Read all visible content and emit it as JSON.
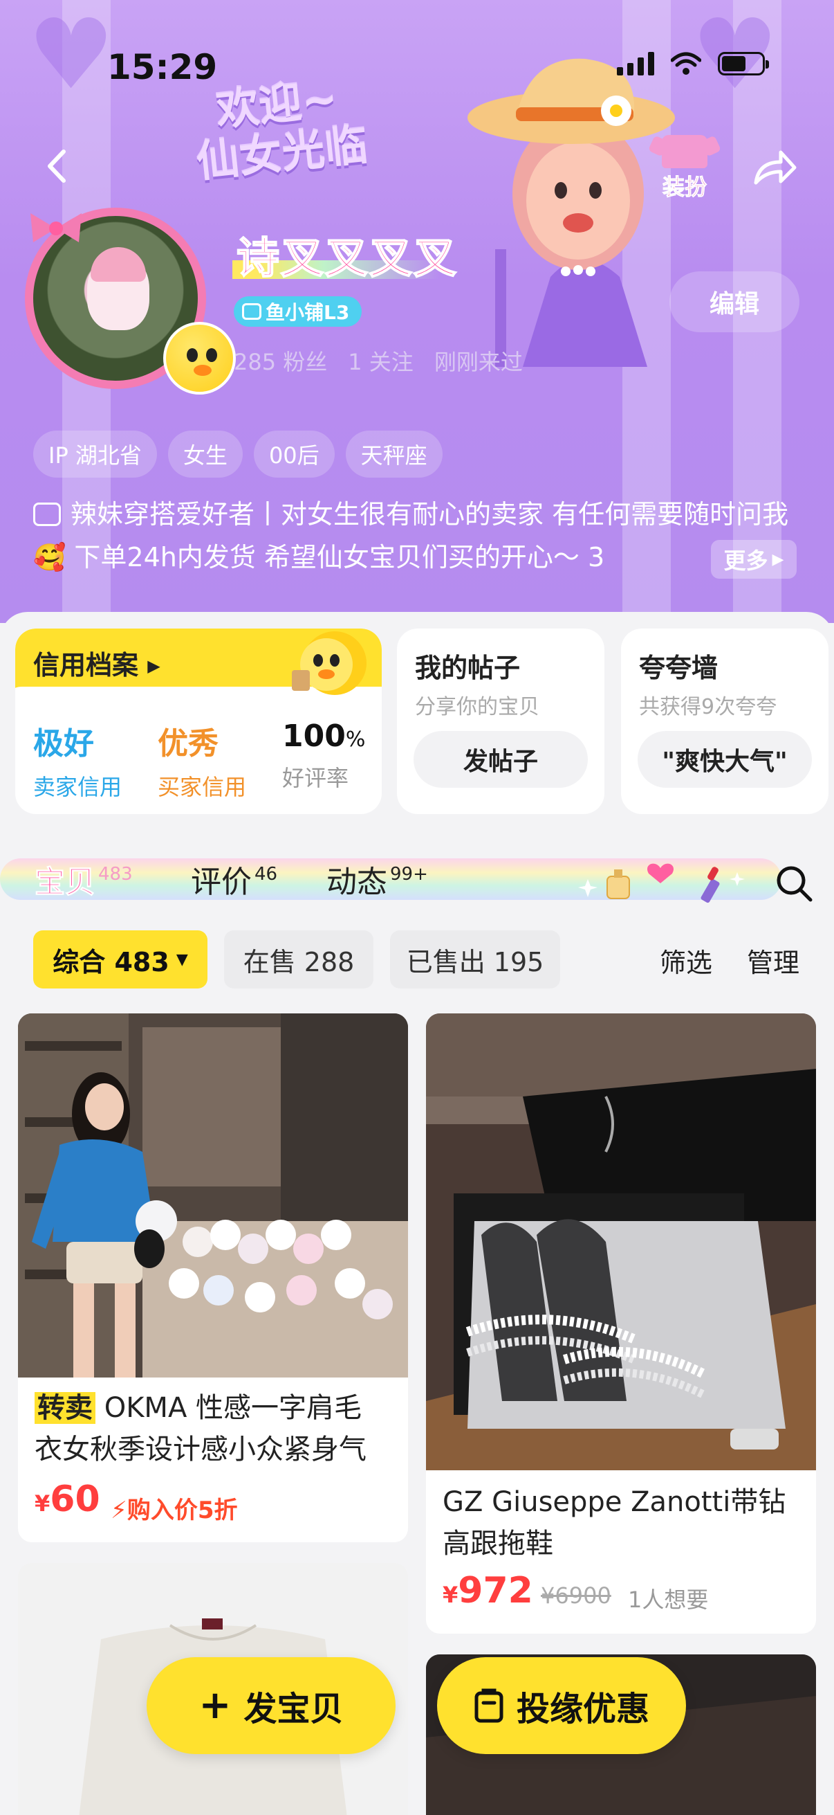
{
  "status_bar": {
    "time": "15:29"
  },
  "header": {
    "banner_line1": "欢迎~",
    "banner_line2": "仙女光临",
    "dressup_label": "装扮",
    "nickname": "诗叉叉叉叉",
    "shop_level": "鱼小铺L3",
    "stats": {
      "fans": "285 粉丝",
      "following": "1 关注",
      "last_seen": "刚刚来过"
    },
    "edit_label": "编辑",
    "tags": [
      "IP 湖北省",
      "女生",
      "00后",
      "天秤座"
    ],
    "bio": "辣妹穿搭爱好者丨对女生很有耐心的卖家 有任何需要随时问我🥰 下单24h内发货 希望仙女宝贝们买的开心～ 3",
    "more_label": "更多"
  },
  "credit_card": {
    "title": "信用档案",
    "seller": {
      "value": "极好",
      "label": "卖家信用",
      "color": "#2aa7e8"
    },
    "buyer": {
      "value": "优秀",
      "label": "买家信用",
      "color": "#f2912a"
    },
    "rating": {
      "value": "100",
      "unit": "%",
      "label": "好评率"
    }
  },
  "posts_card": {
    "title": "我的帖子",
    "subtitle": "分享你的宝贝",
    "button": "发帖子"
  },
  "praise_card": {
    "title": "夸夸墙",
    "subtitle": "共获得9次夸夸",
    "button": "\"爽快大气\""
  },
  "tabs": [
    {
      "label": "宝贝",
      "count": "483",
      "active": true
    },
    {
      "label": "评价",
      "count": "46",
      "active": false
    },
    {
      "label": "动态",
      "count": "99+",
      "active": false
    }
  ],
  "filters": {
    "all": "综合 483",
    "on_sale": "在售 288",
    "sold": "已售出 195",
    "filter": "筛选",
    "manage": "管理"
  },
  "products": [
    {
      "tag": "转卖",
      "title_line1": "OKMA 性感一字肩毛",
      "title_line2": "衣女秋季设计感小众紧身气",
      "yen": "¥",
      "price": "60",
      "discount": "购入价5折"
    },
    {
      "title_line1": "GZ Giuseppe Zanotti带钻",
      "title_line2": "高跟拖鞋",
      "yen": "¥",
      "price": "972",
      "old_price": "¥6900",
      "wants": "1人想要"
    }
  ],
  "fab": {
    "post_item": "发宝贝",
    "coupon": "投缘优惠"
  },
  "colors": {
    "accent_yellow": "#ffe12e",
    "pink": "#ff4f9e",
    "price_red": "#ff3e3e",
    "purple_bg": "#b88cf0"
  }
}
